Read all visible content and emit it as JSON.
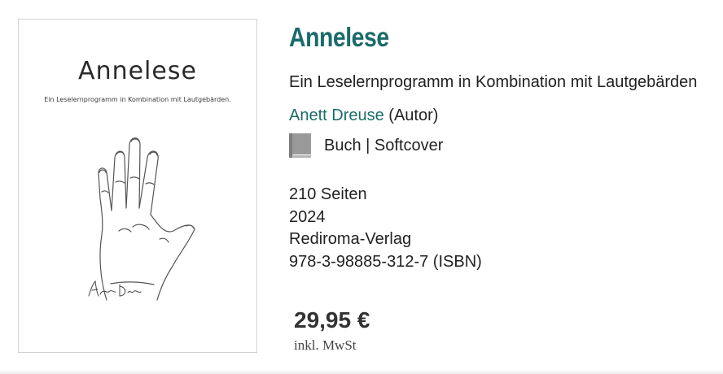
{
  "cover": {
    "title": "Annelese",
    "subtitle": "Ein Leselernprogramm in Kombination mit Lautgebärden."
  },
  "product": {
    "title": "Annelese",
    "subtitle": "Ein Leselernprogramm in Kombination mit Lautgebärden",
    "author_name": "Anett Dreuse",
    "author_role": "(Autor)",
    "format_icon": "book-icon",
    "format": "Buch | Softcover",
    "details": [
      "210 Seiten",
      "2024",
      "Rediroma-Verlag",
      "978-3-98885-312-7 (ISBN)"
    ],
    "price": "29,95 €",
    "vat_note": "inkl. MwSt"
  },
  "colors": {
    "accent": "#1a6b6a",
    "text": "#222222",
    "icon": "#9a9a9a"
  }
}
